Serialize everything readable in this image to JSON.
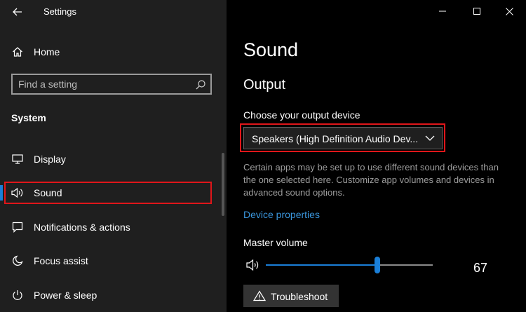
{
  "window": {
    "title": "Settings"
  },
  "sidebar": {
    "home_label": "Home",
    "search": {
      "placeholder": "Find a setting"
    },
    "section_title": "System",
    "items": [
      {
        "label": "Display",
        "icon": "monitor-icon",
        "selected": false
      },
      {
        "label": "Sound",
        "icon": "speaker-icon",
        "selected": true
      },
      {
        "label": "Notifications & actions",
        "icon": "notification-icon",
        "selected": false
      },
      {
        "label": "Focus assist",
        "icon": "moon-icon",
        "selected": false
      },
      {
        "label": "Power & sleep",
        "icon": "power-icon",
        "selected": false
      }
    ]
  },
  "main": {
    "page_title": "Sound",
    "output": {
      "heading": "Output",
      "device_label": "Choose your output device",
      "device_value": "Speakers (High Definition Audio Dev...",
      "description": "Certain apps may be set up to use different sound devices than the one selected here. Customize app volumes and devices in advanced sound options.",
      "device_properties_link": "Device properties",
      "master_volume_label": "Master volume",
      "master_volume_value": 67,
      "troubleshoot_label": "Troubleshoot"
    }
  },
  "colors": {
    "accent": "#1a7fd8",
    "link": "#3a96dd",
    "highlight": "#e0161a",
    "sidebar_bg": "#1f1f1f",
    "main_bg": "#000000"
  }
}
